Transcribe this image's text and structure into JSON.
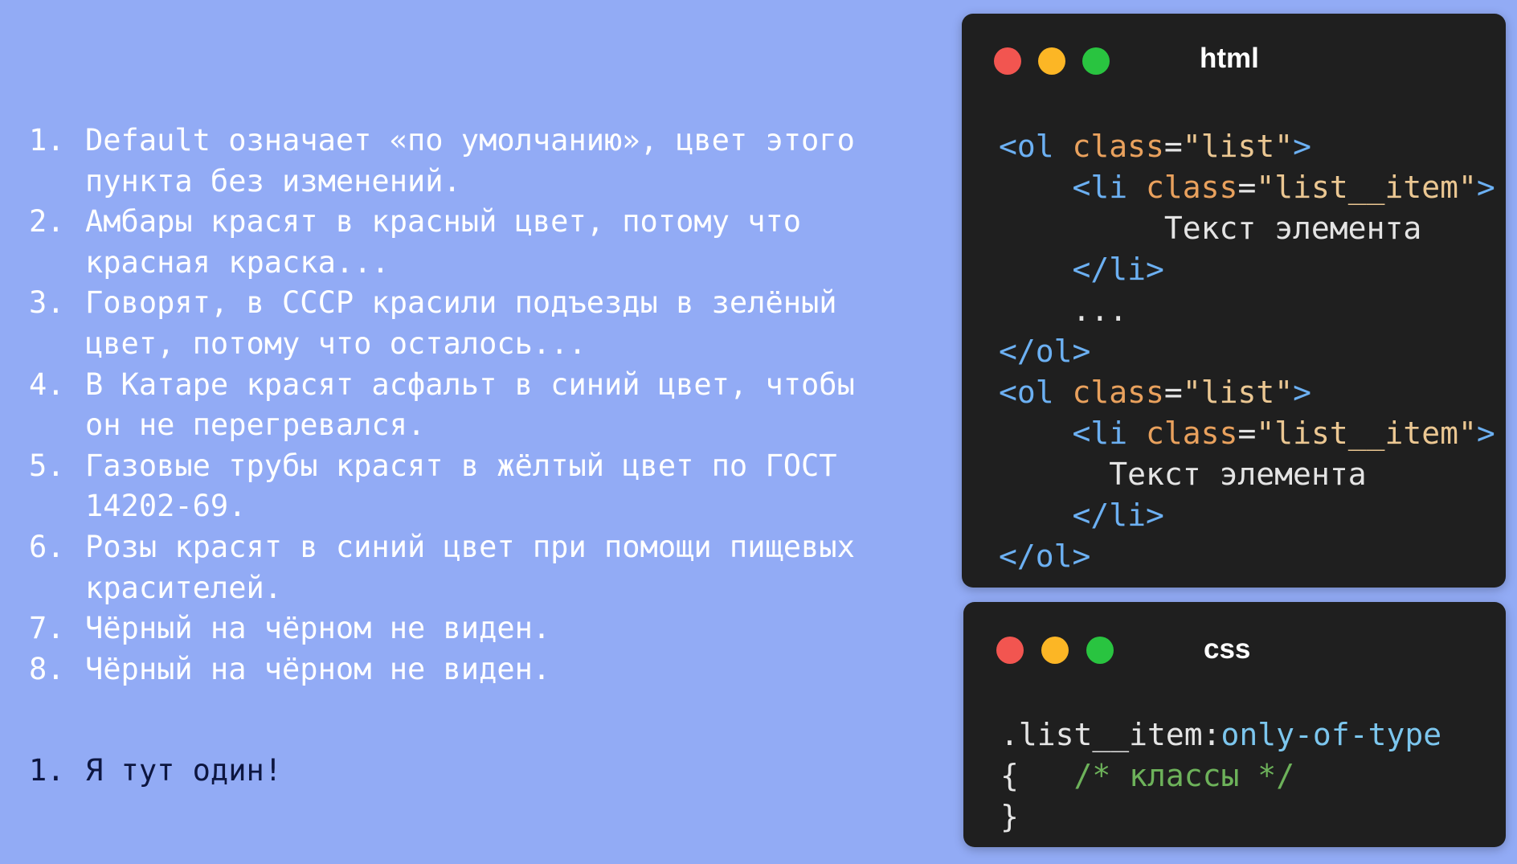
{
  "list_a": {
    "items": [
      {
        "num": "1.",
        "text": "Default означает «по умолчанию», цвет этого пункта без изменений."
      },
      {
        "num": "2.",
        "text": "Амбары красят в красный цвет, потому что красная краска..."
      },
      {
        "num": "3.",
        "text": "Говорят, в СССР красили подъезды в зелёный цвет, потому что осталось..."
      },
      {
        "num": "4.",
        "text": "В Катаре красят асфальт в синий цвет, чтобы он не перегревался."
      },
      {
        "num": "5.",
        "text": "Газовые трубы красят в жёлтый цвет по ГОСТ 14202-69."
      },
      {
        "num": "6.",
        "text": "Розы красят в синий цвет при помощи пищевых красителей."
      },
      {
        "num": "7.",
        "text": "Чёрный на чёрном не виден."
      },
      {
        "num": "8.",
        "text": "Чёрный на чёрном не виден."
      }
    ]
  },
  "list_b": {
    "items": [
      {
        "num": "1.",
        "text": "Я тут один!"
      }
    ]
  },
  "html_window": {
    "title": "html",
    "code": {
      "l1": {
        "open": "<ol",
        "attr": " class",
        "eq": "=",
        "val": "\"list\"",
        "close": ">"
      },
      "l2": {
        "indent": "    ",
        "open": "<li",
        "attr": " class",
        "eq": "=",
        "val": "\"list__item\"",
        "close": ">"
      },
      "l3": {
        "indent": "         ",
        "text": "Текст элемента"
      },
      "l4": {
        "indent": "    ",
        "tag": "</li>"
      },
      "l5": {
        "indent": "    ",
        "text": "..."
      },
      "l6": {
        "tag": "</ol>"
      },
      "l7": {
        "open": "<ol",
        "attr": " class",
        "eq": "=",
        "val": "\"list\"",
        "close": ">"
      },
      "l8": {
        "indent": "    ",
        "open": "<li",
        "attr": " class",
        "eq": "=",
        "val": "\"list__item\"",
        "close": ">"
      },
      "l9": {
        "indent": "      ",
        "text": "Текст элемента"
      },
      "l10": {
        "indent": "    ",
        "tag": "</li>"
      },
      "l11": {
        "tag": "</ol>"
      }
    }
  },
  "css_window": {
    "title": "css",
    "code": {
      "selector": ".list__item:",
      "pseudo": "only-of-type",
      "brace_open": "{",
      "gap": "   ",
      "comment": "/* классы */",
      "brace_close": "}"
    }
  },
  "colors": {
    "background": "#92abf5",
    "list_a_text": "#ffffff",
    "list_b_text": "#0d1640",
    "window_bg": "#1f1f1f",
    "dot_red": "#f25550",
    "dot_yellow": "#fcb625",
    "dot_green": "#29c440",
    "code_tag": "#6cb0f2",
    "code_attr": "#e9a15d",
    "code_string": "#ebc792",
    "code_pseudo": "#7cc6ee",
    "code_comment": "#6db25a"
  },
  "icons": [
    "close-dot-icon",
    "minimize-dot-icon",
    "maximize-dot-icon"
  ]
}
